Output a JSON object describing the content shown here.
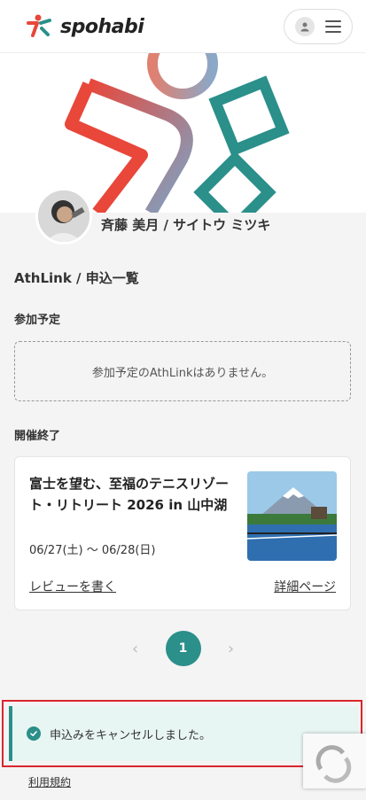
{
  "header": {
    "brand": "spohabi",
    "colors": {
      "red": "#e8473a",
      "teal": "#2b8f8a",
      "blue": "#7aa6c8"
    }
  },
  "profile": {
    "name": "斉藤 美月 / サイトウ ミツキ"
  },
  "page": {
    "title": "AthLink / 申込一覧",
    "upcoming_heading": "参加予定",
    "upcoming_empty": "参加予定のAthLinkはありません。",
    "ended_heading": "開催終了"
  },
  "event": {
    "title": "富士を望む、至福のテニスリゾート・リトリート 2026 in 山中湖",
    "date": "06/27(土) 〜 06/28(日)",
    "review_link": "レビューを書く",
    "detail_link": "詳細ページ"
  },
  "pagination": {
    "current": "1",
    "prev": "‹",
    "next": "›"
  },
  "toast": {
    "message": "申込みをキャンセルしました。"
  },
  "footer": {
    "terms": "利用規約"
  }
}
